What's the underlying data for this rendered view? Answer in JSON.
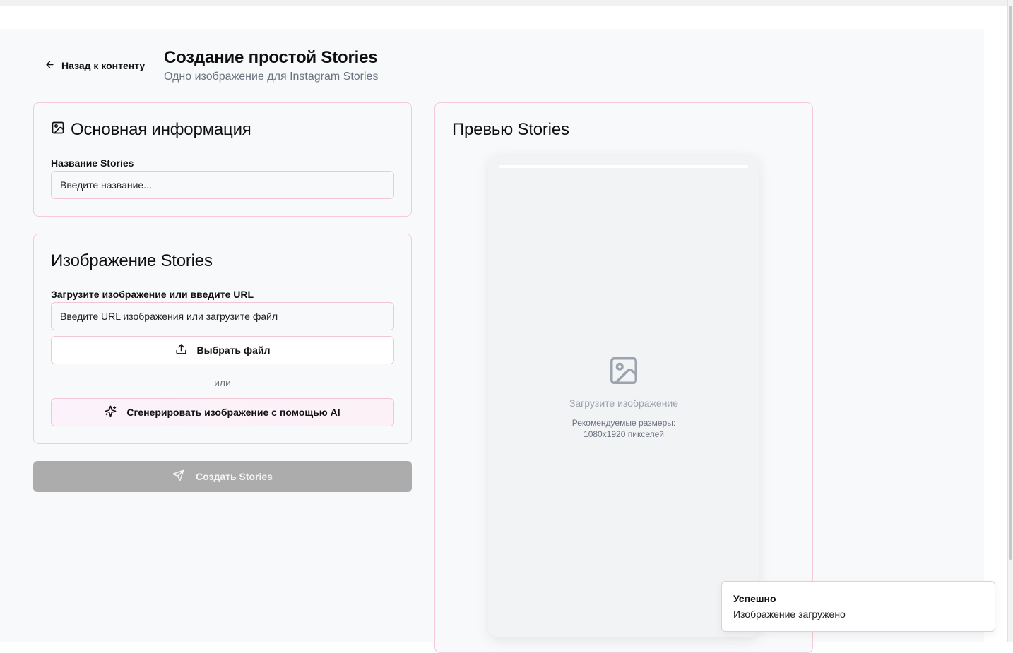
{
  "header": {
    "back_label": "Назад к контенту",
    "title": "Создание простой Stories",
    "subtitle": "Одно изображение для Instagram Stories"
  },
  "basic_info": {
    "title": "Основная информация",
    "name_label": "Название Stories",
    "name_placeholder": "Введите название..."
  },
  "image_section": {
    "title": "Изображение Stories",
    "url_label": "Загрузите изображение или введите URL",
    "url_placeholder": "Введите URL изображения или загрузите файл",
    "choose_file_label": "Выбрать файл",
    "or_text": "или",
    "ai_generate_label": "Сгенерировать изображение с помощью AI"
  },
  "submit": {
    "label": "Создать Stories",
    "disabled": true
  },
  "preview": {
    "title": "Превью Stories",
    "placeholder_title": "Загрузите изображение",
    "hint_line1": "Рекомендуемые размеры:",
    "hint_line2": "1080x1920 пикселей"
  },
  "toast": {
    "title": "Успешно",
    "message": "Изображение загружено"
  },
  "icons": {
    "back": "arrow-left-icon",
    "info": "image-icon",
    "upload": "upload-icon",
    "ai": "sparkles-icon",
    "submit": "send-icon",
    "preview_placeholder": "image-placeholder-icon"
  },
  "colors": {
    "card_border": "#f5c9d6",
    "submit_disabled": "#acacac",
    "background": "#f8f9fb"
  }
}
